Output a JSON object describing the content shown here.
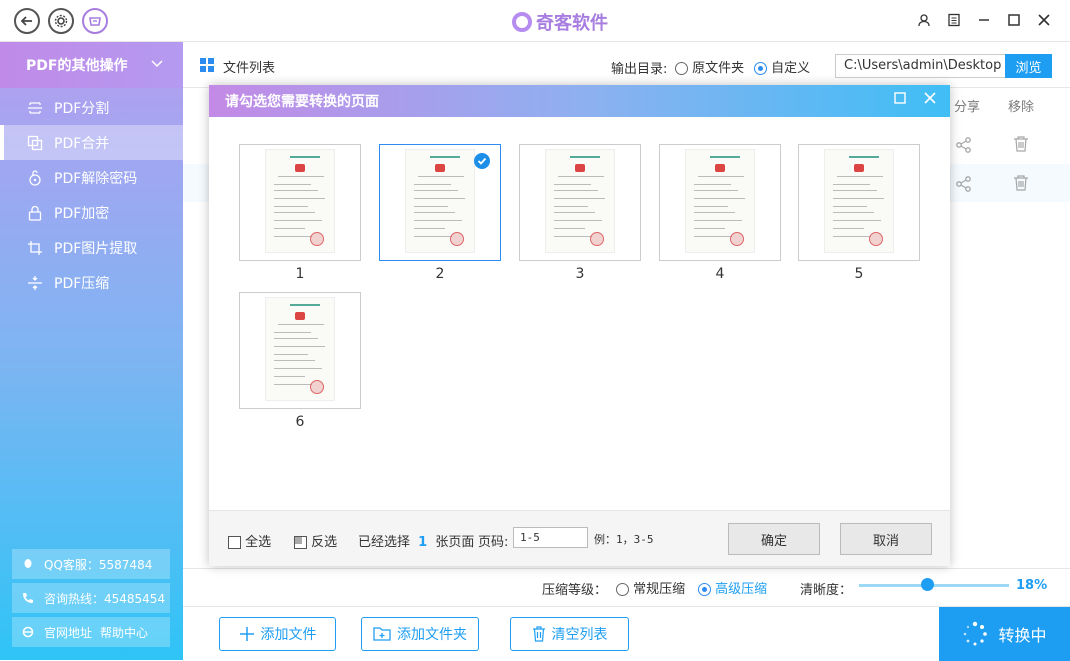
{
  "app": {
    "name": "奇客软件"
  },
  "sidebar": {
    "header": "PDF的其他操作",
    "items": [
      {
        "label": "PDF分割",
        "icon": "split-icon"
      },
      {
        "label": "PDF合并",
        "icon": "merge-icon"
      },
      {
        "label": "PDF解除密码",
        "icon": "unlock-icon"
      },
      {
        "label": "PDF加密",
        "icon": "lock-icon"
      },
      {
        "label": "PDF图片提取",
        "icon": "crop-icon"
      },
      {
        "label": "PDF压缩",
        "icon": "compress-icon"
      }
    ],
    "active_index": 1,
    "footer": {
      "qq": "QQ客服：5587484",
      "hotline": "咨询热线：45485454",
      "website": "官网地址",
      "help": "帮助中心"
    }
  },
  "main": {
    "file_list_title": "文件列表",
    "output_dir_label": "输出目录:",
    "output_option_original": "原文件夹",
    "output_option_custom": "自定义",
    "output_selected": "自定义",
    "output_path": "C:\\Users\\admin\\Desktop",
    "browse_label": "浏览",
    "columns": {
      "share": "分享",
      "remove": "移除"
    },
    "compression_label": "压缩等级：",
    "compression_normal": "常规压缩",
    "compression_advanced": "高级压缩",
    "compression_selected": "高级压缩",
    "clarity_label": "清晰度：",
    "clarity_value": "18%",
    "clarity_fraction": 0.18,
    "add_file": "添加文件",
    "add_folder": "添加文件夹",
    "clear_list": "清空列表",
    "convert": "转换中"
  },
  "dialog": {
    "title": "请勾选您需要转换的页面",
    "pages": [
      {
        "num": "1",
        "selected": false
      },
      {
        "num": "2",
        "selected": true
      },
      {
        "num": "3",
        "selected": false
      },
      {
        "num": "4",
        "selected": false
      },
      {
        "num": "5",
        "selected": false
      },
      {
        "num": "6",
        "selected": false
      }
    ],
    "select_all": "全选",
    "invert": "反选",
    "selected_prefix": "已经选择",
    "selected_count": "1",
    "selected_suffix": "张页面",
    "page_code_label": "页码:",
    "page_code_value": "1-5",
    "example": "例：1，3-5",
    "confirm": "确定",
    "cancel": "取消"
  },
  "colors": {
    "accent": "#1e9ef2",
    "brand": "#a77de0"
  }
}
